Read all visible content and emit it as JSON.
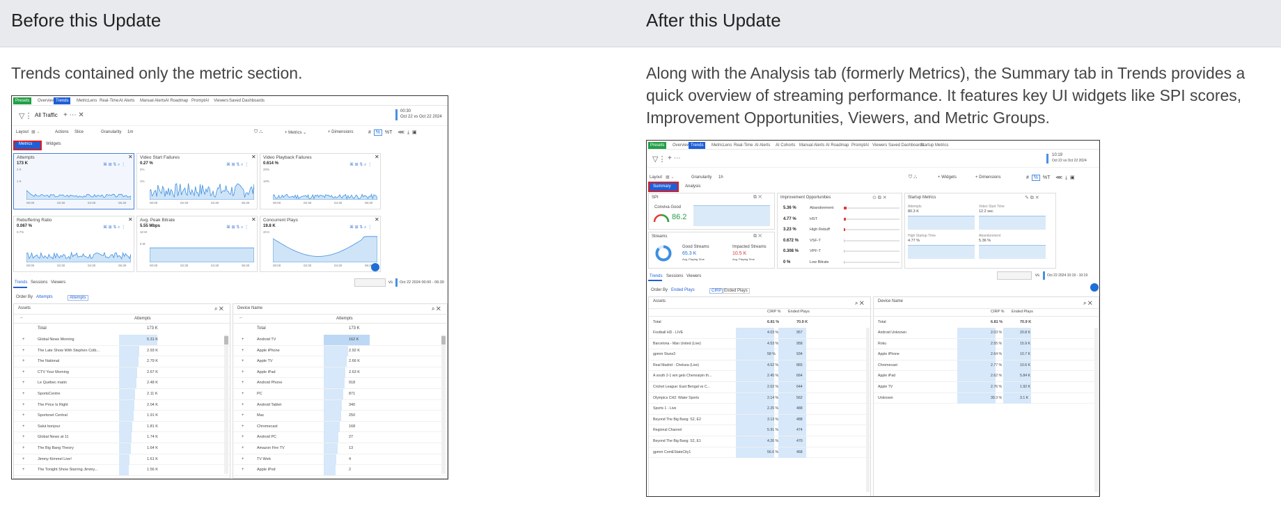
{
  "left": {
    "header": "Before this Update",
    "description": "Trends contained only the metric section.",
    "screenshot": {
      "tabs": [
        "Presets",
        "Overview",
        "Trends",
        "MetricLens",
        "Real-Time",
        "AI Alerts",
        "Manual Alerts",
        "AI Roadmap",
        "PromptAI",
        "Viewers",
        "Saved Dashboards"
      ],
      "filter_label": "All Traffic",
      "date_top": "00:30",
      "date_bottom": "Oct 22 vs Oct 22 2024",
      "layout_label": "Layout",
      "actions_label": "Actions",
      "actions_value": "Slice",
      "granularity_label": "Granularity",
      "granularity_value": "1m",
      "metrics_button": "Metrics",
      "dimensions_button": "Dimensions",
      "view_tabs": [
        "Metrics",
        "Widgets"
      ],
      "cards": [
        {
          "title": "Attempts",
          "value": "173 K",
          "ytop": "2 K",
          "ymid": "1 K"
        },
        {
          "title": "Video Start Failures",
          "value": "0.27 %",
          "ytop": "2%",
          "ymid": "1%"
        },
        {
          "title": "Video Playback Failures",
          "value": "0.614 %",
          "ytop": "20%",
          "ymid": "10%"
        },
        {
          "title": "Rebuffering Ratio",
          "value": "0.067 %",
          "ytop": "0.7%",
          "ymid": ""
        },
        {
          "title": "Avg. Peak Bitrate",
          "value": "5.55 Mbps",
          "ytop": "10 M",
          "ymid": "5 M"
        },
        {
          "title": "Concurrent Plays",
          "value": "19.8 K",
          "ytop": "20 K",
          "ymid": ""
        }
      ],
      "xticks": [
        "00:00",
        "02:30",
        "04:30",
        "06:30"
      ],
      "section_tabs": [
        "Trends",
        "Sessions",
        "Viewers"
      ],
      "date_compare": "Oct 22 2024 00:00 - 06:30",
      "order_by_label": "Order By",
      "order_by_value": "Attempts",
      "order_chip": "Attempts",
      "assets_table": {
        "title": "Assets",
        "column": "Attempts",
        "total_label": "Total",
        "total_value": "173 K",
        "rows": [
          [
            "Global News Morning",
            "5.31 K"
          ],
          [
            "The Late Show With Stephen Colb...",
            "2.93 K"
          ],
          [
            "The National",
            "2.79 K"
          ],
          [
            "CTV Your Morning",
            "2.67 K"
          ],
          [
            "Le Québec matin",
            "2.48 K"
          ],
          [
            "SportsCentre",
            "2.11 K"
          ],
          [
            "The Price Is Right",
            "2.04 K"
          ],
          [
            "Sportsnet Central",
            "1.91 K"
          ],
          [
            "Salut bonjour",
            "1.81 K"
          ],
          [
            "Global News at 11",
            "1.74 K"
          ],
          [
            "The Big Bang Theory",
            "1.64 K"
          ],
          [
            "Jimmy Kimmel Live!",
            "1.61 K"
          ],
          [
            "The Tonight Show Starring Jimmy...",
            "1.56 K"
          ]
        ]
      },
      "device_table": {
        "title": "Device Name",
        "column": "Attempts",
        "total_label": "Total",
        "total_value": "173 K",
        "rows": [
          [
            "Android TV",
            "162 K"
          ],
          [
            "Apple iPhone",
            "2.92 K"
          ],
          [
            "Apple TV",
            "2.66 K"
          ],
          [
            "Apple iPad",
            "2.63 K"
          ],
          [
            "Android Phone",
            "918"
          ],
          [
            "PC",
            "871"
          ],
          [
            "Android Tablet",
            "340"
          ],
          [
            "Mac",
            "250"
          ],
          [
            "Chromecast",
            "168"
          ],
          [
            "Android PC",
            "27"
          ],
          [
            "Amazon Fire TV",
            "13"
          ],
          [
            "TV Web",
            "4"
          ],
          [
            "Apple iPod",
            "2"
          ]
        ]
      }
    }
  },
  "right": {
    "header": "After this Update",
    "description_lines": [
      "Along with the Analysis tab (formerly Metrics), the Summary tab in Trends provides a",
      "quick overview of streaming performance. It features key UI widgets like SPI scores,",
      "Improvement Opportunities, Viewers, and Metric Groups."
    ],
    "screenshot": {
      "tabs": [
        "Presets",
        "Overview",
        "Trends",
        "MetricLens",
        "Real-Time",
        "AI Alerts",
        "AI Cohorts",
        "Manual Alerts",
        "AI Roadmap",
        "PromptAI",
        "Viewers",
        "Saved Dashboards",
        "Startup Metrics"
      ],
      "date_top": "10:19",
      "date_bottom": "Oct 22 vs Oct 22 2024",
      "layout_label": "Layout",
      "granularity_label": "Granularity",
      "granularity_value": "1h",
      "widgets_button": "Widgets",
      "dimensions_button": "Dimensions",
      "view_tabs": [
        "Summary",
        "Analysis"
      ],
      "spi": {
        "title": "SPI",
        "label": "Conviva Good",
        "value": "86.2"
      },
      "streams": {
        "title": "Streams",
        "good_label": "Good Streams",
        "good_value": "65.3 K",
        "good_sub": "Avg. Playing Time",
        "impacted_label": "Impacted Streams",
        "impacted_value": "10.5 K",
        "impacted_sub": "Avg. Playing Time"
      },
      "improvement": {
        "title": "Improvement Opportunities",
        "rows": [
          {
            "pct": "5.36 %",
            "name": "Abandonment",
            "fill": 0.05
          },
          {
            "pct": "4.77 %",
            "name": "HST",
            "fill": 0.04
          },
          {
            "pct": "3.23 %",
            "name": "High Rebuff",
            "fill": 0.03
          },
          {
            "pct": "0.672 %",
            "name": "VSF-T",
            "fill": 0.01
          },
          {
            "pct": "0.308 %",
            "name": "VPF-T",
            "fill": 0.005
          },
          {
            "pct": "0 %",
            "name": "Low Bitrate",
            "fill": 0
          }
        ]
      },
      "startup": {
        "title": "Startup Metrics",
        "items": [
          {
            "label": "Attempts",
            "value": "80.3 K"
          },
          {
            "label": "Video Start Time",
            "value": "12.2 sec"
          },
          {
            "label": "High Startup Time",
            "value": "4.77 %"
          },
          {
            "label": "Abandonment",
            "value": "5.36 %"
          }
        ]
      },
      "section_tabs": [
        "Trends",
        "Sessions",
        "Viewers"
      ],
      "date_compare": "Oct 22 2024 10:19 - 10:19",
      "order_by_label": "Order By",
      "order_by_value": "Ended Plays",
      "order_chips": [
        "CIRP",
        "Ended Plays"
      ],
      "assets_table": {
        "title": "Assets",
        "col1": "CIRP %",
        "col2": "Ended Plays",
        "total_label": "Total",
        "total_v1": "6.81 %",
        "total_v2": "70.9 K",
        "rows": [
          [
            "Football HD - LIVE",
            "4.03 %",
            "957"
          ],
          [
            "Barcelona - Man United (Live)",
            "4.53 %",
            "958"
          ],
          [
            "gpmm Stuns3",
            "58 %",
            "934"
          ],
          [
            "Real Madrid - Chelsea (Live)",
            "4.52 %",
            "865"
          ],
          [
            "A south 2-1 win gets Chennaiyin th...",
            "2.45 %",
            "664"
          ],
          [
            "Cricket League: East Bengal vs C...",
            "2.02 %",
            "644"
          ],
          [
            "Olympics CH2: Water Sports",
            "2.14 %",
            "562"
          ],
          [
            "Sports 1 - Live",
            "2.25 %",
            "488"
          ],
          [
            "Beyond The Big Bang: S2, E2",
            "3.13 %",
            "488"
          ],
          [
            "Regional Channel",
            "5.91 %",
            "474"
          ],
          [
            "Beyond The Big Bang: S2, E1",
            "4.26 %",
            "470"
          ],
          [
            "gpmm ComEStateCity1",
            "56.6 %",
            "468"
          ]
        ]
      },
      "device_table": {
        "title": "Device Name",
        "col1": "CIRP %",
        "col2": "Ended Plays",
        "total_label": "Total",
        "total_v1": "6.81 %",
        "total_v2": "70.9 K",
        "rows": [
          [
            "Android Unknown",
            "2.03 %",
            "20.8 K"
          ],
          [
            "Roku",
            "2.55 %",
            "15.9 K"
          ],
          [
            "Apple iPhone",
            "2.64 %",
            "10.7 K"
          ],
          [
            "Chromecast",
            "2.77 %",
            "10.6 K"
          ],
          [
            "Apple iPad",
            "2.62 %",
            "5.84 K"
          ],
          [
            "Apple TV",
            "2.76 %",
            "1.92 K"
          ],
          [
            "Unknown",
            "39.3 %",
            "3.1 K"
          ]
        ]
      }
    }
  }
}
